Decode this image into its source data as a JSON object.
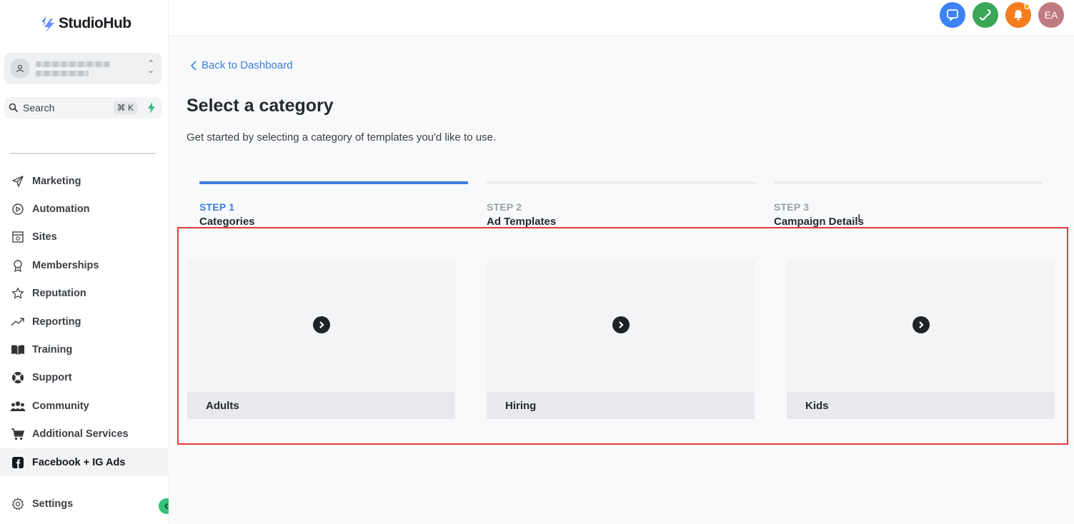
{
  "brand": {
    "name": "StudioHub"
  },
  "search": {
    "label": "Search",
    "shortcut": "⌘ K"
  },
  "sidebar": {
    "items": [
      {
        "label": "Marketing",
        "icon": "send-icon"
      },
      {
        "label": "Automation",
        "icon": "automation-icon"
      },
      {
        "label": "Sites",
        "icon": "sites-icon"
      },
      {
        "label": "Memberships",
        "icon": "award-icon"
      },
      {
        "label": "Reputation",
        "icon": "star-icon"
      },
      {
        "label": "Reporting",
        "icon": "trending-icon"
      },
      {
        "label": "Training",
        "icon": "book-icon"
      },
      {
        "label": "Support",
        "icon": "lifebuoy-icon"
      },
      {
        "label": "Community",
        "icon": "users-icon"
      },
      {
        "label": "Additional Services",
        "icon": "cart-icon"
      },
      {
        "label": "Facebook + IG Ads",
        "icon": "facebook-icon",
        "active": true
      }
    ],
    "settings_label": "Settings"
  },
  "topbar": {
    "user_initials": "EA"
  },
  "main": {
    "back_label": "Back to Dashboard",
    "title": "Select a category",
    "subtitle": "Get started by selecting a category of templates you'd like to use.",
    "steps": [
      {
        "num": "STEP 1",
        "name": "Categories"
      },
      {
        "num": "STEP 2",
        "name": "Ad Templates"
      },
      {
        "num": "STEP 3",
        "name": "Campaign Details"
      }
    ],
    "categories": [
      {
        "label": "Adults"
      },
      {
        "label": "Hiring"
      },
      {
        "label": "Kids"
      }
    ]
  },
  "colors": {
    "accent": "#3b7de0",
    "highlight": "#e53a3a",
    "brand_green": "#35c37a"
  }
}
